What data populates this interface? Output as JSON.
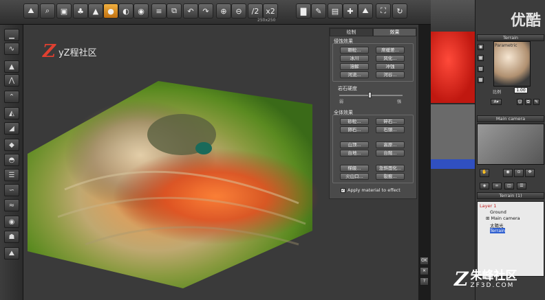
{
  "toolbar": {
    "size_readout": "250x250",
    "half_label": "/2",
    "double_label": "x2"
  },
  "viewport": {
    "logo_text": "yZ程社区",
    "logo_mark": "Z"
  },
  "effects_panel": {
    "tabs": [
      "绘制",
      "效果"
    ],
    "erosion_label": "侵蚀效果",
    "erosion_buttons": [
      "颗粒...",
      "席缓差...",
      "冰川",
      "风化...",
      "溶解",
      "冲蚀",
      "河流...",
      "河谷..."
    ],
    "rock_hardness_label": "岩石硬度",
    "slider_min": "弱",
    "slider_max": "强",
    "rock_hardness_value": 0.5,
    "global_label": "全体效果",
    "global_buttons": [
      "砂粒...",
      "碎石...",
      "卵石...",
      "石頭...",
      "山顶...",
      "高原...",
      "台地...",
      "台階...",
      "梯級...",
      "急斜面化...",
      "火山口...",
      "裂痕..."
    ],
    "apply_label": "Apply material to effect",
    "apply_checked": true
  },
  "side_buttons": [
    "OK",
    "✕",
    "?"
  ],
  "right_panel": {
    "watermark_top": "优酷",
    "terrain_header": "Terrain",
    "material_name": "Parametric",
    "scale_label": "比例",
    "scale_value": "1.00",
    "camera_header": "Main camera",
    "layer_header": "Terrain (1)",
    "tree": {
      "layer": "Layer 1",
      "ground": "Ground",
      "camera": "Main camera",
      "sun": "太陽光",
      "terrain": "Terrain"
    }
  },
  "watermark": {
    "mark": "Z",
    "main": "朱峰社区",
    "sub": "ZF3D.COM"
  },
  "colors": {
    "accent": "#f0b040",
    "tree_selection": "#3060d0",
    "logo": "#e04030"
  }
}
